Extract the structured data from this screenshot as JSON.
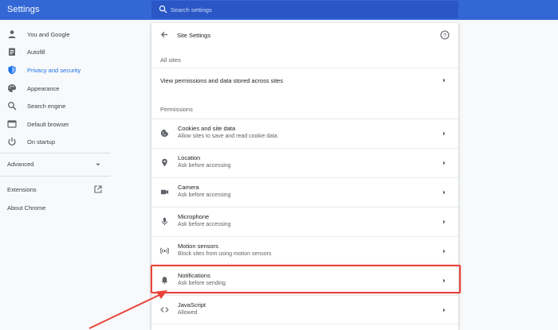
{
  "header": {
    "title": "Settings",
    "search_placeholder": "Search settings"
  },
  "sidebar": {
    "items": [
      {
        "label": "You and Google",
        "icon": "person-icon"
      },
      {
        "label": "Autofill",
        "icon": "clipboard-icon"
      },
      {
        "label": "Privacy and security",
        "icon": "shield-icon",
        "active": true
      },
      {
        "label": "Appearance",
        "icon": "palette-icon"
      },
      {
        "label": "Search engine",
        "icon": "search-icon"
      },
      {
        "label": "Default browser",
        "icon": "browser-icon"
      },
      {
        "label": "On startup",
        "icon": "power-icon"
      }
    ],
    "advanced": "Advanced",
    "extensions": "Extensions",
    "about": "About Chrome"
  },
  "page": {
    "title": "Site Settings",
    "all_sites_heading": "All sites",
    "all_sites_row": "View permissions and data stored across sites",
    "permissions_heading": "Permissions",
    "rows": [
      {
        "title": "Cookies and site data",
        "subtitle": "Allow sites to save and read cookie data",
        "icon": "cookie-icon"
      },
      {
        "title": "Location",
        "subtitle": "Ask before accessing",
        "icon": "location-pin-icon"
      },
      {
        "title": "Camera",
        "subtitle": "Ask before accessing",
        "icon": "camera-icon"
      },
      {
        "title": "Microphone",
        "subtitle": "Ask before accessing",
        "icon": "microphone-icon"
      },
      {
        "title": "Motion sensors",
        "subtitle": "Block sites from using motion sensors",
        "icon": "sensors-icon"
      },
      {
        "title": "Notifications",
        "subtitle": "Ask before sending",
        "icon": "bell-icon"
      },
      {
        "title": "JavaScript",
        "subtitle": "Allowed",
        "icon": "code-icon"
      }
    ]
  },
  "colors": {
    "toolbar": "#3367d6",
    "accent": "#1a73e8",
    "annotation": "#e8443a"
  }
}
